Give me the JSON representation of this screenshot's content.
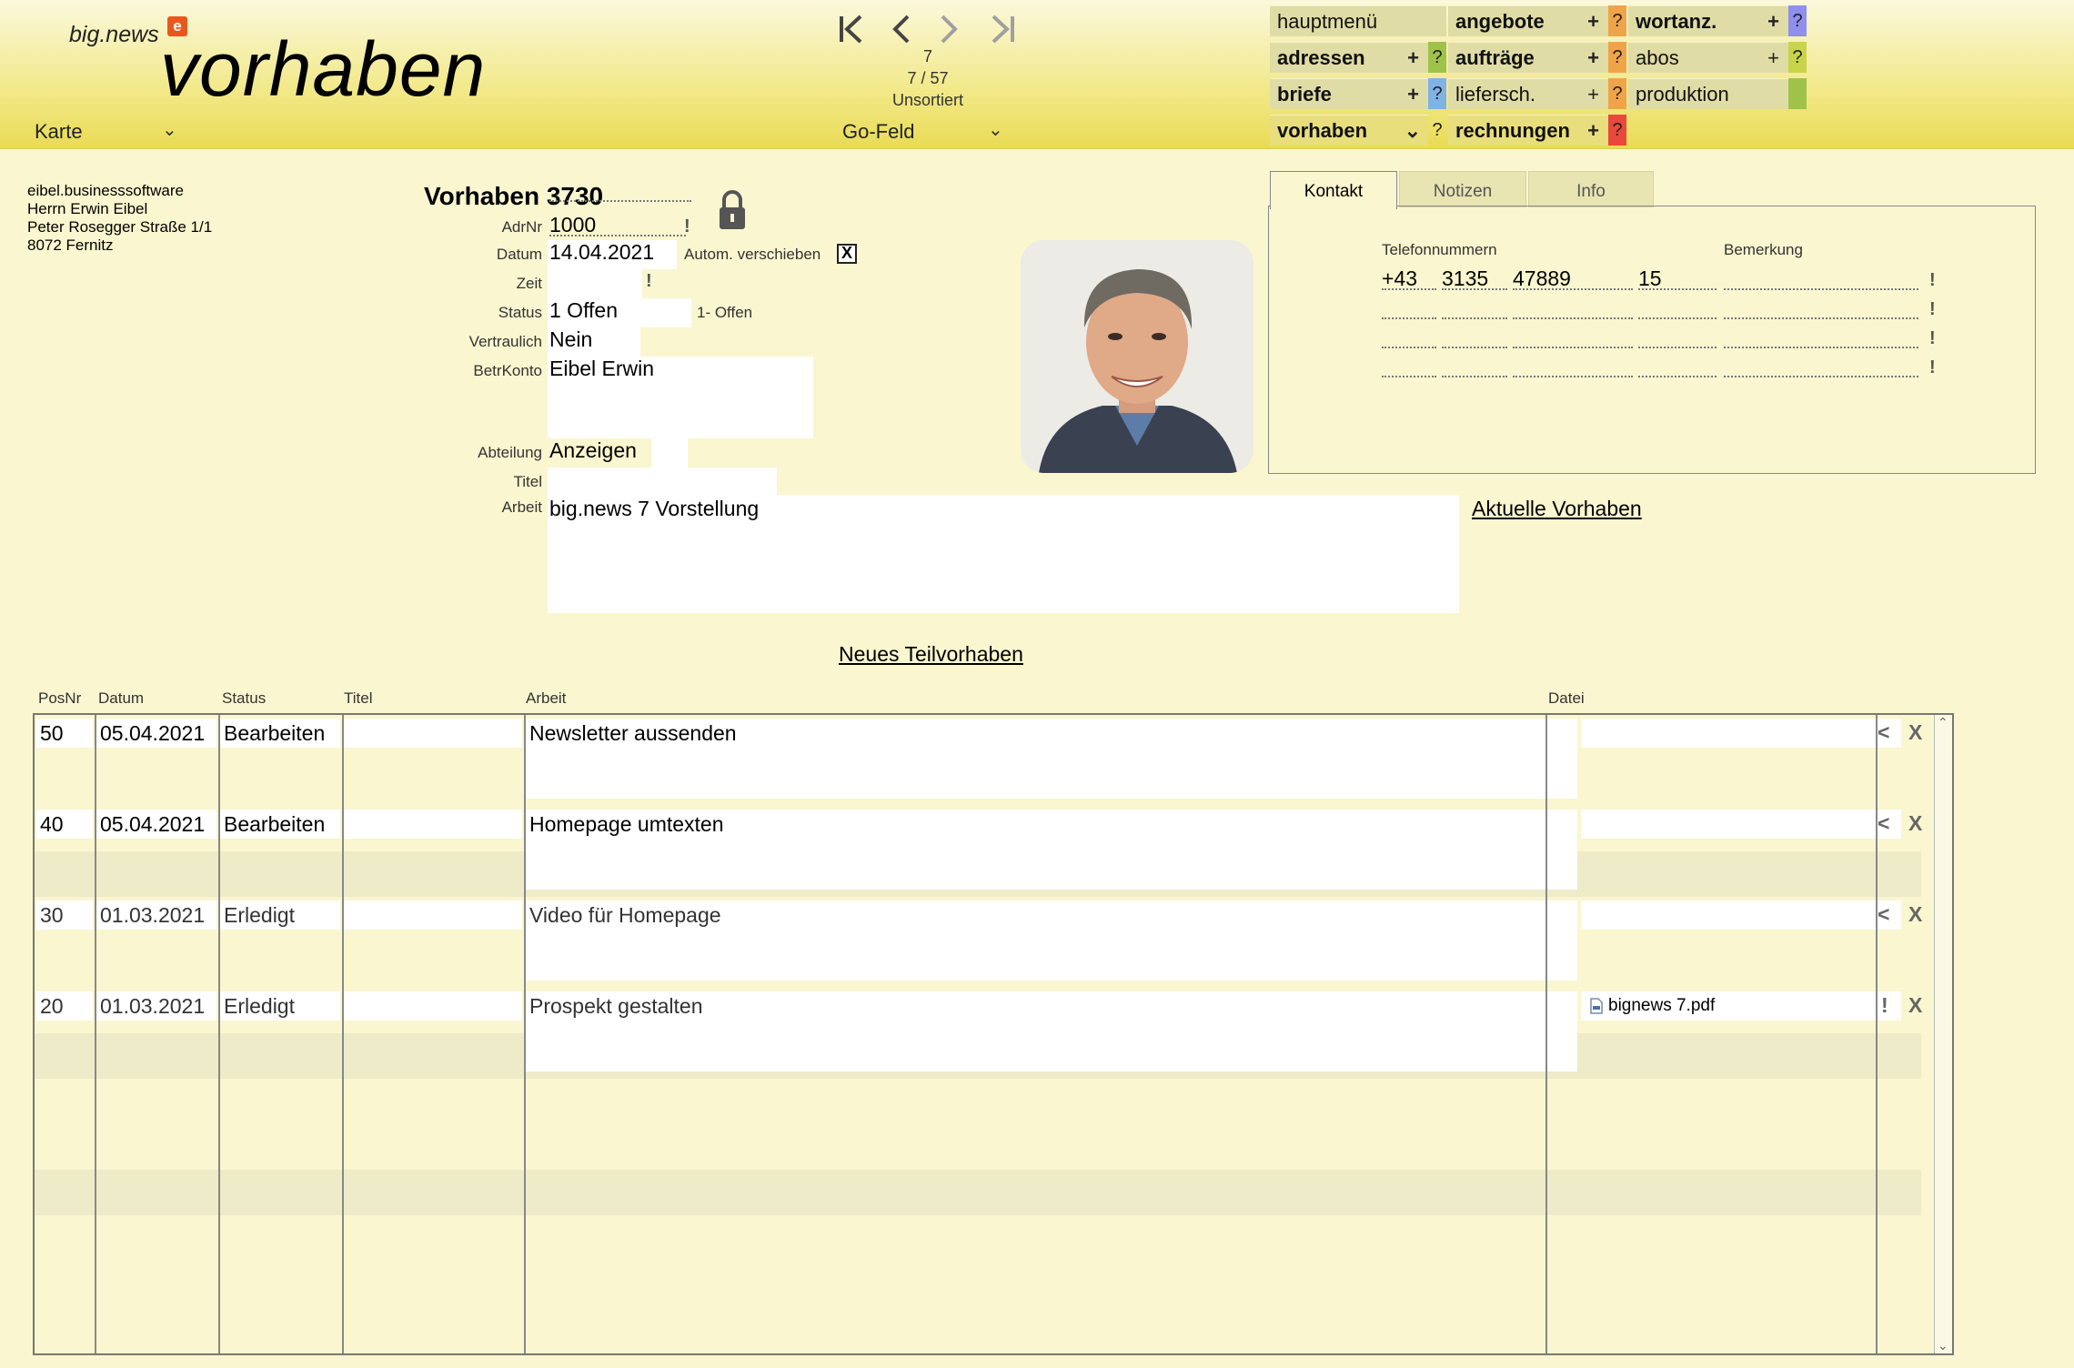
{
  "header": {
    "brand": "big.news",
    "brand_logo": "e",
    "title": "vorhaben",
    "layout_label": "Karte",
    "record_current": "7",
    "record_position": "7 / 57",
    "sort_state": "Unsortiert",
    "go_field": "Go-Feld"
  },
  "menu": {
    "hauptmenue": "hauptmenü",
    "angebote": "angebote",
    "wortanz": "wortanz.",
    "adressen": "adressen",
    "auftraege": "aufträge",
    "abos": "abos",
    "briefe": "briefe",
    "liefersch": "liefersch.",
    "produktion": "produktion",
    "vorhaben": "vorhaben",
    "rechnungen": "rechnungen",
    "plus": "+",
    "question": "?",
    "chevron": "⌄"
  },
  "address": {
    "line1": "eibel.businesssoftware",
    "line2": "Herrn Erwin Eibel",
    "line3": "Peter Rosegger Straße 1/1",
    "line4": "8072 Fernitz"
  },
  "form": {
    "heading": "Vorhaben 3730",
    "adrnr_label": "AdrNr",
    "adrnr": "1000",
    "datum_label": "Datum",
    "datum": "14.04.2021",
    "autom_label": "Autom. verschieben",
    "autom_checked": "X",
    "zeit_label": "Zeit",
    "zeit": "",
    "status_label": "Status",
    "status": "1 Offen",
    "status_hint": "1- Offen",
    "vertraulich_label": "Vertraulich",
    "vertraulich": "Nein",
    "betrkonto_label": "BetrKonto",
    "betrkonto": "Eibel Erwin",
    "abteilung_label": "Abteilung",
    "abteilung": "Anzeigen",
    "titel_label": "Titel",
    "titel": "",
    "arbeit_label": "Arbeit",
    "arbeit": "big.news 7 Vorstellung",
    "excl": "!"
  },
  "tabs": {
    "kontakt": "Kontakt",
    "notizen": "Notizen",
    "info": "Info",
    "telefon_header": "Telefonnummern",
    "bemerkung_header": "Bemerkung",
    "phone": {
      "country": "+43",
      "area": "3135",
      "number": "47889",
      "ext": "15"
    }
  },
  "links": {
    "aktuelle": "Aktuelle Vorhaben",
    "neues": "Neues Teilvorhaben"
  },
  "table": {
    "headers": {
      "posnr": "PosNr",
      "datum": "Datum",
      "status": "Status",
      "titel": "Titel",
      "arbeit": "Arbeit",
      "datei": "Datei"
    },
    "rows": [
      {
        "posnr": "50",
        "datum": "05.04.2021",
        "status": "Bearbeiten",
        "titel": "",
        "arbeit": "Newsletter aussenden",
        "datei": "",
        "action": "<",
        "delete": "X"
      },
      {
        "posnr": "40",
        "datum": "05.04.2021",
        "status": "Bearbeiten",
        "titel": "",
        "arbeit": "Homepage umtexten",
        "datei": "",
        "action": "<",
        "delete": "X"
      },
      {
        "posnr": "30",
        "datum": "01.03.2021",
        "status": "Erledigt",
        "titel": "",
        "arbeit": "Video für Homepage",
        "datei": "",
        "action": "<",
        "delete": "X"
      },
      {
        "posnr": "20",
        "datum": "01.03.2021",
        "status": "Erledigt",
        "titel": "",
        "arbeit": "Prospekt gestalten",
        "datei": "bignews 7.pdf",
        "action": "!",
        "delete": "X"
      }
    ]
  },
  "colors": {
    "background": "#faf6cf",
    "header_yellow": "#e9db55",
    "accent_orange": "#f0a44a",
    "accent_red": "#e8493a"
  },
  "icons": {
    "first": "first-record-icon",
    "prev": "previous-record-icon",
    "next": "next-record-icon",
    "last": "last-record-icon",
    "lock": "lock-icon",
    "pdf": "pdf-file-icon"
  }
}
